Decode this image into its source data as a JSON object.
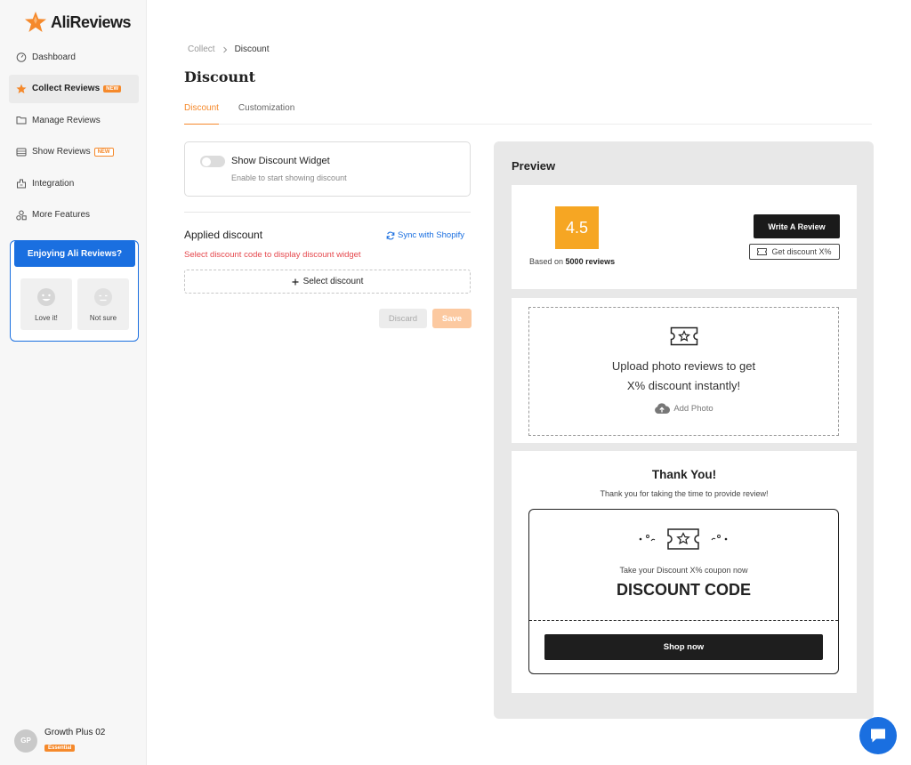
{
  "app": {
    "name": "AliReviews",
    "brand_color": "#f5892b",
    "accent_color": "#1a6fe0"
  },
  "sidebar": {
    "items": [
      {
        "label": "Dashboard",
        "icon": "dashboard-icon",
        "badge": ""
      },
      {
        "label": "Collect Reviews",
        "icon": "star-icon",
        "badge": "NEW",
        "active": true
      },
      {
        "label": "Manage Reviews",
        "icon": "folder-icon",
        "badge": ""
      },
      {
        "label": "Show Reviews",
        "icon": "display-icon",
        "badge": "NEW"
      },
      {
        "label": "Integration",
        "icon": "integration-icon",
        "badge": ""
      },
      {
        "label": "More Features",
        "icon": "shapes-icon",
        "badge": ""
      }
    ],
    "enjoy": {
      "title": "Enjoying Ali Reviews?",
      "love": "Love it!",
      "not_sure": "Not sure"
    },
    "user": {
      "initials": "GP",
      "name": "Growth Plus 02",
      "plan": "Essential"
    }
  },
  "breadcrumb": {
    "parent": "Collect",
    "current": "Discount"
  },
  "page": {
    "title": "Discount"
  },
  "tabs": [
    {
      "label": "Discount",
      "active": true
    },
    {
      "label": "Customization",
      "active": false
    }
  ],
  "widget": {
    "title": "Show Discount Widget",
    "subtitle": "Enable to start showing discount",
    "enabled": false
  },
  "applied": {
    "title": "Applied discount",
    "sync_label": "Sync with Shopify",
    "error": "Select discount code to display discount widget",
    "select_label": "Select discount"
  },
  "actions": {
    "discard": "Discard",
    "save": "Save"
  },
  "preview": {
    "title": "Preview",
    "rating": "4.5",
    "based_prefix": "Based on",
    "based_count": "5000 reviews",
    "write_review": "Write A Review",
    "get_discount": "Get discount X%",
    "upload_line1": "Upload photo reviews to get",
    "upload_line2": "X% discount instantly!",
    "add_photo": "Add Photo",
    "thank_you": "Thank You!",
    "thank_sub": "Thank you for taking the time to provide review!",
    "coupon_take": "Take your Discount X% coupon now",
    "coupon_code": "DISCOUNT CODE",
    "shop_now": "Shop now"
  }
}
